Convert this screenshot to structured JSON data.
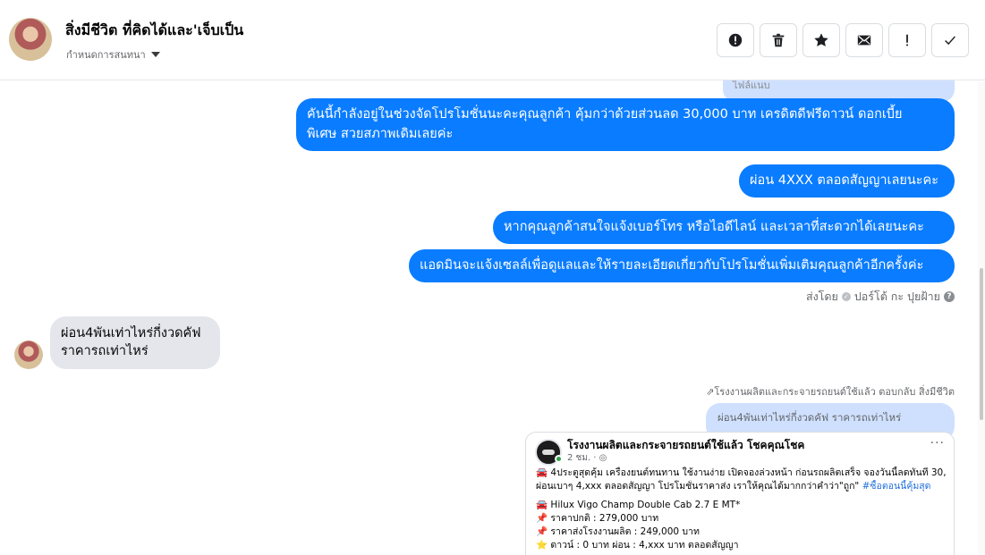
{
  "header": {
    "title": "สิ่งมีชีวิต ที่คิดได้และ'เจ็บเป็น",
    "subtitle": "กำหนดการสนทนา"
  },
  "actions": [
    {
      "name": "report-button",
      "icon": "alert-circle-icon"
    },
    {
      "name": "delete-button",
      "icon": "trash-icon"
    },
    {
      "name": "star-button",
      "icon": "star-icon"
    },
    {
      "name": "mark-unread-button",
      "icon": "envelope-icon"
    },
    {
      "name": "important-button",
      "icon": "exclamation-icon"
    },
    {
      "name": "done-button",
      "icon": "check-icon"
    }
  ],
  "conversation": {
    "attachment_label": "ไฟล์แนบ",
    "outgoing": [
      {
        "lines": [
          "คันนี้กำลังอยู่ในช่วงจัดโปรโมชั่นนะคะคุณลูกค้า คุ้มกว่าด้วยส่วนลด 30,000 บาท เครดิตดีฟรีดาวน์ ดอกเบี้ย",
          "พิเศษ สวยสภาพเดิมเลยค่ะ"
        ]
      },
      {
        "lines": [
          "ผ่อน 4XXX ตลอดสัญญาเลยนะคะ"
        ]
      },
      {
        "lines": [
          "หากคุณลูกค้าสนใจแจ้งเบอร์โทร หรือไอดีไลน์  และเวลาที่สะดวกได้เลยนะคะ"
        ]
      },
      {
        "lines": [
          "แอดมินจะแจ้งเซลล์เพื่อดูแลและให้รายละเอียดเกี่ยวกับโปรโมชั่นเพิ่มเติมคุณลูกค้าอีกครั้งค่ะ"
        ]
      }
    ],
    "sent_by_prefix": "ส่งโดย",
    "sent_by_name": "ปอร์โต้ กะ ปุยฝ้าย",
    "incoming": {
      "lines": [
        "ผ่อน4พันเท่าไหร่กี่งวดคัฟ",
        "ราคารถเท่าไหร่"
      ]
    },
    "reply_note": "โรงงานผลิตและกระจายรถยนต์ใช้แล้ว ตอบกลับ สิ่งมีชีวิต",
    "quoted_text": "ผ่อน4พันเท่าไหร่กี่งวดคัฟ ราคารถเท่าไหร่"
  },
  "post": {
    "page_name": "โรงงานผลิตและกระจายรถยนต์ใช้แล้ว โชคคุณโชค",
    "time": "2 ชม. · ",
    "more": "···",
    "intro_1": "4ประตูสุดคุ้ม เครื่องยนต์ทนทาน ใช้งานง่าย เปิดจองล่วงหน้า ก่อนรถผลิตเสร็จ จองวันนี้ลดทันที 30,000",
    "intro_2": "ผ่อนเบาๆ 4,xxx ตลอดสัญญา โปรโมชั่นราคาส่ง เราให้คุณได้มากกว่าคำว่า\"ถูก\" ",
    "hashtag": "#ซื้อตอนนี้คุ้มสุด",
    "model": "Hilux Vigo Champ Double Cab 2.7 E MT*",
    "price_normal": "ราคาปกติ : 279,000  บาท",
    "price_factory": "ราคาส่งโรงงานผลิต : 249,000 บาท",
    "down": "ดาวน์ : 0 บาท ผ่อน : 4,xxx บาท ตลอดสัญญา"
  }
}
